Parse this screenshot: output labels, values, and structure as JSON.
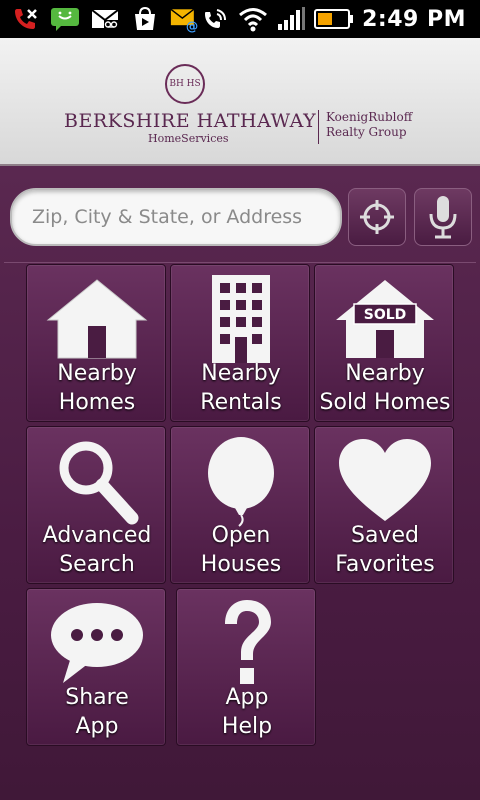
{
  "status_bar": {
    "time": "2:49 PM",
    "icons": [
      "missed-call-icon",
      "sms-icon",
      "voicemail-icon",
      "play-store-icon",
      "email-icon",
      "wifi-calling-icon",
      "wifi-icon",
      "signal-icon",
      "battery-icon"
    ],
    "colors": {
      "sms": "#55b83f",
      "missed_call": "#d42020",
      "email": "#f4b400"
    }
  },
  "header": {
    "seal_text": "BH HS",
    "brand_name": "BERKSHIRE HATHAWAY",
    "brand_sub": "HomeServices",
    "partner_line1": "KoenigRubloff",
    "partner_line2": "Realty Group"
  },
  "search": {
    "placeholder": "Zip, City & State, or Address",
    "value": ""
  },
  "tiles": [
    {
      "line1": "Nearby",
      "line2": "Homes",
      "icon": "house-icon"
    },
    {
      "line1": "Nearby",
      "line2": "Rentals",
      "icon": "building-icon"
    },
    {
      "line1": "Nearby",
      "line2": "Sold Homes",
      "icon": "sold-house-icon",
      "badge": "SOLD"
    },
    {
      "line1": "Advanced",
      "line2": "Search",
      "icon": "magnifier-icon"
    },
    {
      "line1": "Open",
      "line2": "Houses",
      "icon": "balloon-icon"
    },
    {
      "line1": "Saved",
      "line2": "Favorites",
      "icon": "heart-icon"
    },
    {
      "line1": "Share",
      "line2": "App",
      "icon": "speech-bubble-icon"
    },
    {
      "line1": "App",
      "line2": "Help",
      "icon": "question-mark-icon"
    }
  ],
  "theme": {
    "primary": "#5a2850",
    "tile_text": "#ffffff"
  }
}
